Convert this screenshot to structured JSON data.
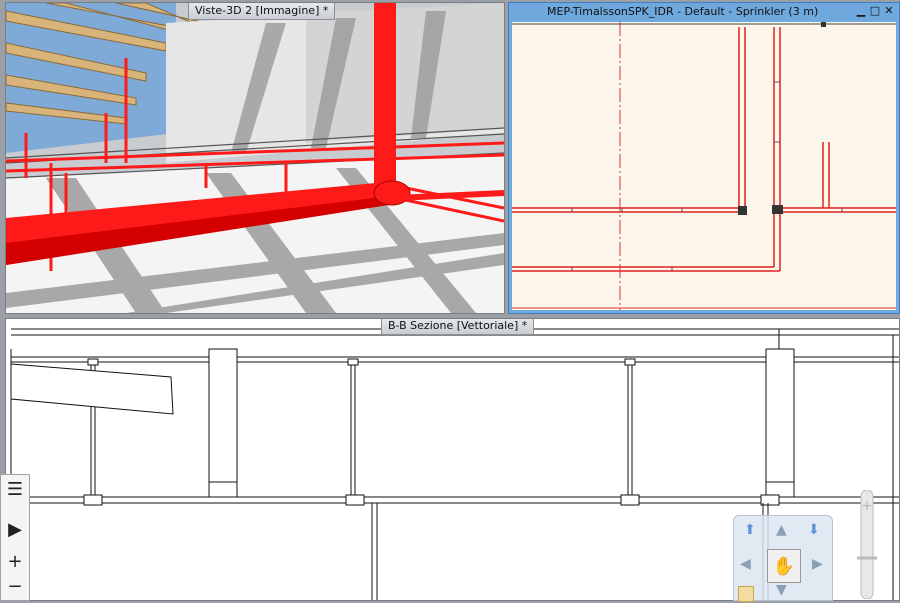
{
  "views": {
    "view3d": {
      "tab_title": "Viste-3D 2 [Immagine] *"
    },
    "plan": {
      "window_title": "MEP-TimalssonSPK_IDR - Default - Sprinkler (3 m)",
      "minimize_icon": "minimize-icon",
      "maximize_icon": "maximize-icon",
      "close_icon": "close-icon"
    },
    "section": {
      "tab_title": "B-B Sezione [Vettoriale] *"
    }
  },
  "toolbar": {
    "items": [
      {
        "icon": "list-icon",
        "glyph": "☰"
      },
      {
        "icon": "play-icon",
        "glyph": "▶"
      },
      {
        "icon": "zoom-in-icon",
        "glyph": "+"
      },
      {
        "icon": "zoom-out-icon",
        "glyph": "−"
      }
    ]
  },
  "colors": {
    "pipe_red": "#ff1a1a",
    "plan_bg": "#fdf6ea",
    "active_border": "#6fa8dc"
  }
}
